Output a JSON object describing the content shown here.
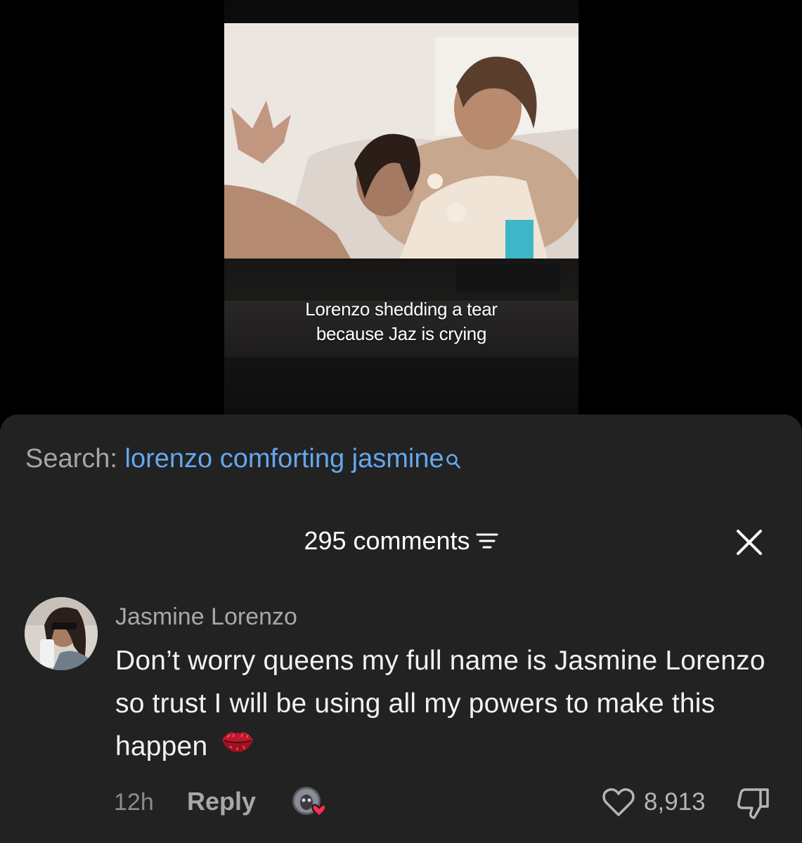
{
  "video": {
    "caption_line1": "Lorenzo shedding a tear",
    "caption_line2": "because Jaz is crying"
  },
  "search": {
    "prefix": "Search:",
    "query": "lorenzo comforting jasmine",
    "icon": "search-icon"
  },
  "comments_header": {
    "count_label": "295 comments",
    "filter_icon": "filter-icon",
    "close_icon": "close-icon"
  },
  "comment": {
    "username": "Jasmine Lorenzo",
    "text": "Don’t worry queens my full name is Jasmine Lorenzo so trust I will be using all my powers to make this happen",
    "emoji_icon": "kiss-lips-icon",
    "timestamp": "12h",
    "reply_label": "Reply",
    "likes": "8,913",
    "creator_liked": true
  },
  "colors": {
    "sheet_bg": "#222222",
    "search_query": "#64a7ee",
    "search_prefix": "#a6a6a6",
    "heart_red": "#fe2c55"
  }
}
